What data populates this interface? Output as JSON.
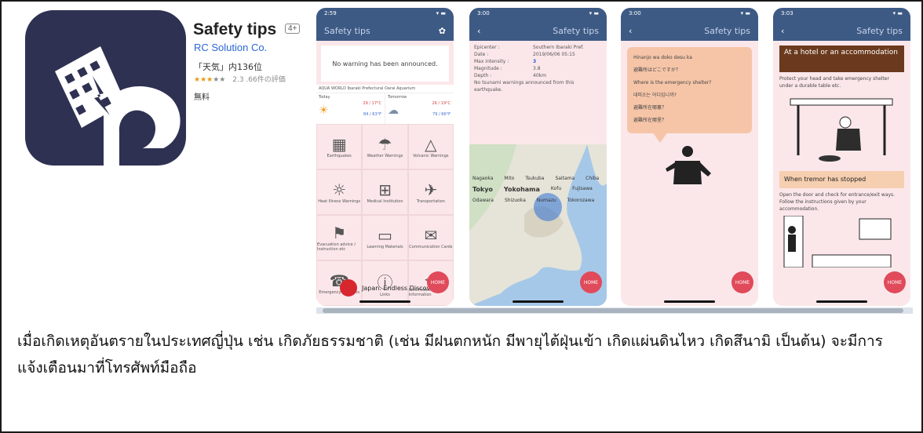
{
  "app": {
    "title": "Safety tips",
    "age_badge": "4+",
    "developer": "RC Solution Co.",
    "rank": "「天気」内136位",
    "rating_value": "2.3",
    "rating_text": "2.3 .66件の評価",
    "price": "無料"
  },
  "screens": {
    "s1": {
      "time": "2:59",
      "nav_title": "Safety tips",
      "warning": "No warning has been announced.",
      "location": "AQUA WORLD Ibaraki Prefectural Oarai Aquarium",
      "today_label": "Today",
      "tomorrow_label": "Tomorrow",
      "today_temps": "29 /  17°C",
      "today_temps2": "84 /  63°F",
      "tomorrow_temps": "26 /  19°C",
      "tomorrow_temps2": "79 /  66°F",
      "menu": [
        "Earthquakes",
        "Weather Warnings",
        "Volcanic Warnings",
        "Heat Illness Warnings",
        "Medical Institution",
        "Transportation",
        "Evacuation advice / Instruction etc",
        "Learning Materials",
        "Communication Cards",
        "Emergency Contacts",
        "Links",
        "Civil Protection Information"
      ],
      "footer_brand": "Japan. Endless Discovery."
    },
    "s2": {
      "time": "3:00",
      "nav_title": "Safety tips",
      "epicenter_label": "Epicenter :",
      "epicenter_value": "Southern Ibaraki Pref.",
      "date_label": "Date :",
      "date_value": "2019/06/06 05:15",
      "intensity_label": "Max intensity :",
      "intensity_value": "3",
      "magnitude_label": "Magnitude :",
      "magnitude_value": "3.8",
      "depth_label": "Depth :",
      "depth_value": "40km",
      "note": "No tsunami warnings announced from this earthquake.",
      "map_labels": [
        "Nagaoka",
        "Mito",
        "Tsukuba",
        "Saitama",
        "Chiba",
        "Tokyo",
        "Yokohama",
        "Kofu",
        "Fujisawa",
        "Odawara",
        "Shizuoka",
        "Numazu",
        "Tokorozawa"
      ]
    },
    "s3": {
      "time": "3:00",
      "nav_title": "Safety tips",
      "phrases": [
        "Hinanjo wa doko desu ka",
        "避難所はどこですか？",
        "Where is the emergency shelter?",
        "대피소는 어디입니까?",
        "避難所在哪裏？",
        "避難所在哪里？"
      ]
    },
    "s4": {
      "time": "3:03",
      "nav_title": "Safety tips",
      "heading1": "At a hotel or an accommodation",
      "body1": "Protect your head and take emergency shelter under a durable table etc.",
      "heading2": "When tremor has stopped",
      "body2": "Open the door and check for entrance/exit ways. Follow the instructions given by your accommodation."
    },
    "home_label": "HOME"
  },
  "caption": "เมื่อเกิดเหตุอันตรายในประเทศญี่ปุ่น เช่น เกิดภัยธรรมชาติ (เช่น มีฝนตกหนัก มีพายุไต้ฝุ่นเข้า เกิดแผ่นดินไหว เกิดสึนามิ เป็นต้น) จะมีการแจ้งเตือนมาที่โทรศัพท์มือถือ",
  "colors": {
    "navy": "#3d5a85",
    "icon_bg": "#2e3152",
    "accent_red": "#e04a5a",
    "pink_bg": "#fbe7ea",
    "brown_heading": "#6b3a1e"
  }
}
